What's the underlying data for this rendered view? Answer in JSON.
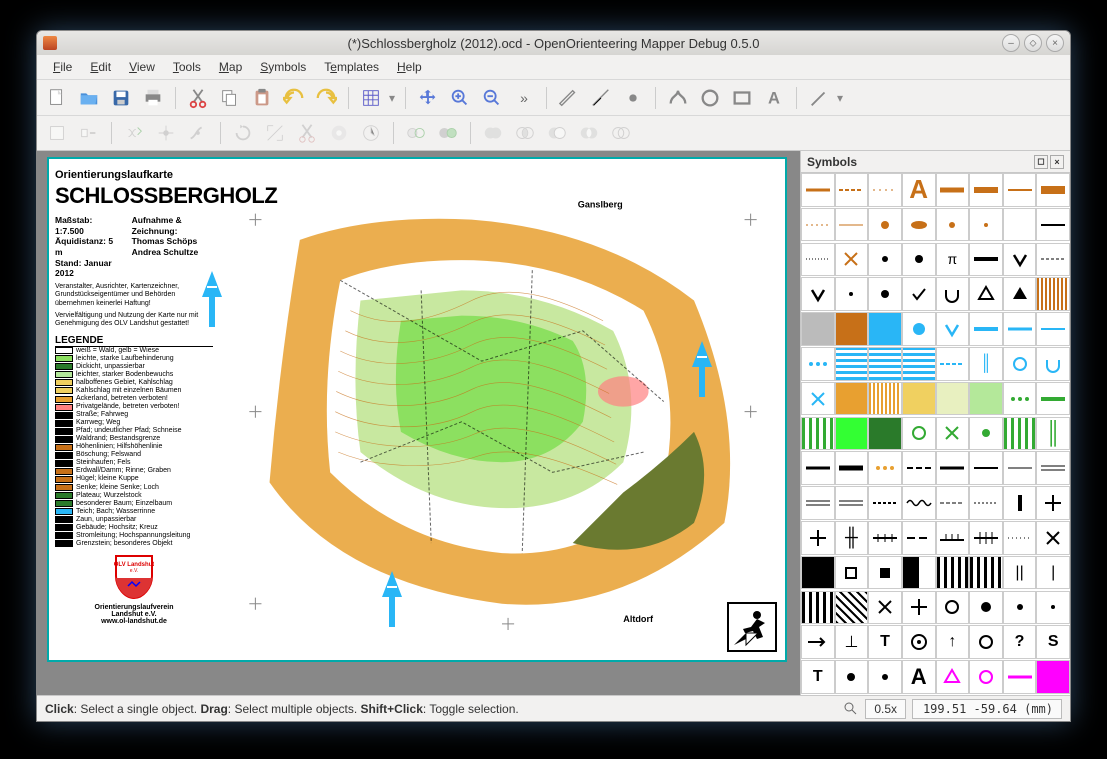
{
  "window": {
    "title": "(*)Schlossbergholz (2012).ocd - OpenOrienteering Mapper Debug 0.5.0"
  },
  "menu": {
    "file": "File",
    "edit": "Edit",
    "view": "View",
    "tools": "Tools",
    "map": "Map",
    "symbols": "Symbols",
    "templates": "Templates",
    "help": "Help"
  },
  "symbols_panel": {
    "title": "Symbols"
  },
  "statusbar": {
    "help_html": "<b>Click</b>: Select a single object. <b>Drag</b>: Select multiple objects. <b>Shift+Click</b>: Toggle selection.",
    "zoom": "0.5x",
    "coords": "199.51 -59.64 (mm)"
  },
  "map": {
    "subtitle": "Orientierungslaufkarte",
    "title": "SCHLOSSBERGHOLZ",
    "scale_label": "Maßstab:",
    "scale_value": "1:7.500",
    "equi_label": "Äquidistanz:",
    "equi_value": "5 m",
    "stand_label": "Stand:",
    "stand_value": "Januar 2012",
    "survey_label": "Aufnahme & Zeichnung:",
    "surveyor1": "Thomas Schöps",
    "surveyor2": "Andrea Schultze",
    "disclaimer1": "Veranstalter, Ausrichter, Kartenzeichner, Grundstückseigentümer und Behörden übernehmen keinerlei Haftung!",
    "disclaimer2": "Vervielfältigung und Nutzung der Karte nur mit Genehmigung des OLV Landshut gestattet!",
    "legende": "LEGENDE",
    "legend_items": [
      "weiß = Wald, gelb = Wiese",
      "leichte, starke Laufbehinderung",
      "Dickicht, unpassierbar",
      "leichter, starker Bodenbewuchs",
      "halboffenes Gebiet, Kahlschlag",
      "Kahlschlag mit einzelnen Bäumen",
      "Ackerland, betreten verboten!",
      "Privatgelände, betreten verboten!",
      "Straße; Fahrweg",
      "Karrweg; Weg",
      "Pfad; undeutlicher Pfad; Schneise",
      "Waldrand; Bestandsgrenze",
      "Höhenlinien; Hilfshöhenlinie",
      "Böschung; Felswand",
      "Steinhaufen; Fels",
      "Erdwall/Damm; Rinne; Graben",
      "Hügel; kleine Kuppe",
      "Senke; kleine Senke; Loch",
      "Plateau; Wurzelstock",
      "besonderer Baum; Einzelbaum",
      "Teich; Bach; Wasserrinne",
      "Zaun, unpassierbar",
      "Gebäude; Hochsitz; Kreuz",
      "Stromleitung; Hochspannungsleitung",
      "Grenzstein; besonderes Objekt"
    ],
    "club_name": "OLV Landshut e.V.",
    "club_line1": "Orientierungslaufverein",
    "club_line2": "Landshut e.V.",
    "club_url": "www.ol-landshut.de",
    "place1": "Ganslberg",
    "place2": "Altdorf"
  },
  "legend_colors": [
    "#fff",
    "#8ce060",
    "#2a7a2a",
    "#b4e89a",
    "#f0d060",
    "#f0d060",
    "#e8a030",
    "#ff8080",
    "#000",
    "#000",
    "#000",
    "#000",
    "#c77018",
    "#000",
    "#000",
    "#c77018",
    "#c77018",
    "#c77018",
    "#2a7a2a",
    "#2a7a2a",
    "#29b6f6",
    "#000",
    "#000",
    "#000",
    "#000"
  ],
  "sym_cells": [
    {
      "t": "line",
      "c": "#c77018",
      "w": 3
    },
    {
      "t": "line",
      "c": "#c77018",
      "w": 2,
      "d": "4 2"
    },
    {
      "t": "line",
      "c": "#c77018",
      "w": 1,
      "d": "2 4"
    },
    {
      "t": "txt",
      "c": "#c77018",
      "s": "A",
      "fw": "bold",
      "fs": 26
    },
    {
      "t": "line",
      "c": "#c77018",
      "w": 5
    },
    {
      "t": "line",
      "c": "#c77018",
      "w": 6
    },
    {
      "t": "line",
      "c": "#c77018",
      "w": 2
    },
    {
      "t": "line",
      "c": "#c77018",
      "w": 8
    },
    {
      "t": "line",
      "c": "#c77018",
      "w": 1,
      "d": "2 3"
    },
    {
      "t": "line",
      "c": "#c77018",
      "w": 1
    },
    {
      "t": "dot",
      "c": "#c77018",
      "r": 4
    },
    {
      "t": "ell",
      "c": "#c77018"
    },
    {
      "t": "dot",
      "c": "#c77018",
      "r": 3
    },
    {
      "t": "dot",
      "c": "#c77018",
      "r": 2
    },
    {
      "t": "fill",
      "c": "#fff"
    },
    {
      "t": "line",
      "c": "#000",
      "w": 2
    },
    {
      "t": "line",
      "c": "#000",
      "w": 1,
      "d": "1 2"
    },
    {
      "t": "x",
      "c": "#c77018"
    },
    {
      "t": "dot",
      "c": "#000",
      "r": 3
    },
    {
      "t": "dot",
      "c": "#000",
      "r": 4
    },
    {
      "t": "txt",
      "c": "#000",
      "s": "π",
      "fs": 14
    },
    {
      "t": "line",
      "c": "#000",
      "w": 4
    },
    {
      "t": "v",
      "c": "#000"
    },
    {
      "t": "line",
      "c": "#000",
      "w": 1,
      "d": "3 2"
    },
    {
      "t": "v",
      "c": "#000"
    },
    {
      "t": "dot",
      "c": "#000",
      "r": 2
    },
    {
      "t": "dot",
      "c": "#000",
      "r": 4
    },
    {
      "t": "tick",
      "c": "#000"
    },
    {
      "t": "u",
      "c": "#000"
    },
    {
      "t": "tri",
      "c": "#000"
    },
    {
      "t": "tri",
      "c": "#000",
      "f": 1
    },
    {
      "t": "hatch",
      "c": "#c77018"
    },
    {
      "t": "fill",
      "c": "#bbb"
    },
    {
      "t": "fill",
      "c": "#c77018"
    },
    {
      "t": "fill",
      "c": "#29b6f6"
    },
    {
      "t": "dot",
      "c": "#29b6f6",
      "r": 6
    },
    {
      "t": "v",
      "c": "#29b6f6"
    },
    {
      "t": "line",
      "c": "#29b6f6",
      "w": 4
    },
    {
      "t": "line",
      "c": "#29b6f6",
      "w": 3
    },
    {
      "t": "line",
      "c": "#29b6f6",
      "w": 2
    },
    {
      "t": "dots",
      "c": "#29b6f6"
    },
    {
      "t": "stripes",
      "c": "#29b6f6"
    },
    {
      "t": "stripes",
      "c": "#29b6f6"
    },
    {
      "t": "stripes",
      "c": "#29b6f6"
    },
    {
      "t": "line",
      "c": "#29b6f6",
      "w": 2,
      "d": "4 2"
    },
    {
      "t": "txt",
      "c": "#29b6f6",
      "s": "║"
    },
    {
      "t": "circ",
      "c": "#29b6f6"
    },
    {
      "t": "u",
      "c": "#29b6f6"
    },
    {
      "t": "x",
      "c": "#29b6f6"
    },
    {
      "t": "fill",
      "c": "#e8a030"
    },
    {
      "t": "hatch",
      "c": "#e8a030"
    },
    {
      "t": "fill",
      "c": "#f0d060"
    },
    {
      "t": "fill",
      "c": "#e8f0c0"
    },
    {
      "t": "fill",
      "c": "#b4e89a"
    },
    {
      "t": "dots",
      "c": "#3a3"
    },
    {
      "t": "line",
      "c": "#3a3",
      "w": 4
    },
    {
      "t": "vstripes",
      "c": "#3a3"
    },
    {
      "t": "fill",
      "c": "#3f3"
    },
    {
      "t": "fill",
      "c": "#2a7a2a"
    },
    {
      "t": "circ",
      "c": "#3a3"
    },
    {
      "t": "x",
      "c": "#3a3"
    },
    {
      "t": "dot",
      "c": "#3a3",
      "r": 4
    },
    {
      "t": "vstripes",
      "c": "#3a3"
    },
    {
      "t": "txt",
      "c": "#3a3",
      "s": "║",
      "fs": 22
    },
    {
      "t": "line",
      "c": "#000",
      "w": 3
    },
    {
      "t": "line",
      "c": "#000",
      "w": 5
    },
    {
      "t": "dots",
      "c": "#e8a030"
    },
    {
      "t": "line",
      "c": "#000",
      "w": 2,
      "d": "6 3"
    },
    {
      "t": "line",
      "c": "#000",
      "w": 3
    },
    {
      "t": "line",
      "c": "#000",
      "w": 2
    },
    {
      "t": "line",
      "c": "#000",
      "w": 1
    },
    {
      "t": "dline",
      "c": "#000"
    },
    {
      "t": "dline",
      "c": "#000"
    },
    {
      "t": "dline",
      "c": "#000"
    },
    {
      "t": "line",
      "c": "#000",
      "w": 2,
      "d": "3 2"
    },
    {
      "t": "wave",
      "c": "#000"
    },
    {
      "t": "line",
      "c": "#000",
      "w": 1,
      "d": "4 2"
    },
    {
      "t": "line",
      "c": "#000",
      "w": 1,
      "d": "2 2"
    },
    {
      "t": "bar",
      "c": "#000"
    },
    {
      "t": "cross",
      "c": "#000"
    },
    {
      "t": "cross",
      "c": "#000"
    },
    {
      "t": "txt",
      "c": "#000",
      "s": "╫",
      "fs": 18
    },
    {
      "t": "rail",
      "c": "#000"
    },
    {
      "t": "line",
      "c": "#000",
      "w": 2,
      "d": "8 4"
    },
    {
      "t": "spike",
      "c": "#000"
    },
    {
      "t": "dspike",
      "c": "#000"
    },
    {
      "t": "line",
      "c": "#000",
      "w": 1,
      "d": "1 3"
    },
    {
      "t": "x",
      "c": "#000"
    },
    {
      "t": "fill",
      "c": "#000"
    },
    {
      "t": "sq",
      "c": "#000",
      "f": 0
    },
    {
      "t": "sq",
      "c": "#000",
      "f": 1
    },
    {
      "t": "bw"
    },
    {
      "t": "vstripes",
      "c": "#000"
    },
    {
      "t": "vstripes",
      "c": "#000"
    },
    {
      "t": "txt",
      "c": "#000",
      "s": "||",
      "fs": 16
    },
    {
      "t": "txt",
      "c": "#000",
      "s": "|",
      "fs": 16
    },
    {
      "t": "vstripes",
      "c": "#000"
    },
    {
      "t": "diag",
      "c": "#000"
    },
    {
      "t": "x",
      "c": "#000"
    },
    {
      "t": "cross",
      "c": "#000"
    },
    {
      "t": "circ",
      "c": "#000"
    },
    {
      "t": "dot",
      "c": "#000",
      "r": 5
    },
    {
      "t": "dot",
      "c": "#000",
      "r": 3
    },
    {
      "t": "dot",
      "c": "#000",
      "r": 2
    },
    {
      "t": "arrow",
      "c": "#000"
    },
    {
      "t": "txt",
      "c": "#000",
      "s": "⊥"
    },
    {
      "t": "txt",
      "c": "#000",
      "s": "T",
      "fw": "bold"
    },
    {
      "t": "circdot",
      "c": "#000"
    },
    {
      "t": "txt",
      "c": "#000",
      "s": "↑"
    },
    {
      "t": "circ",
      "c": "#000"
    },
    {
      "t": "txt",
      "c": "#000",
      "s": "?",
      "fw": "bold"
    },
    {
      "t": "txt",
      "c": "#000",
      "s": "S",
      "fw": "bold"
    },
    {
      "t": "txt",
      "c": "#000",
      "s": "T",
      "fw": "bold"
    },
    {
      "t": "dot",
      "c": "#000",
      "r": 4
    },
    {
      "t": "dot",
      "c": "#000",
      "r": 3
    },
    {
      "t": "txt",
      "c": "#000",
      "s": "A",
      "fw": "bold",
      "fs": 22
    },
    {
      "t": "tri",
      "c": "#f0f"
    },
    {
      "t": "circ",
      "c": "#f0f"
    },
    {
      "t": "line",
      "c": "#f0f",
      "w": 3
    },
    {
      "t": "fill",
      "c": "#f0f"
    }
  ]
}
